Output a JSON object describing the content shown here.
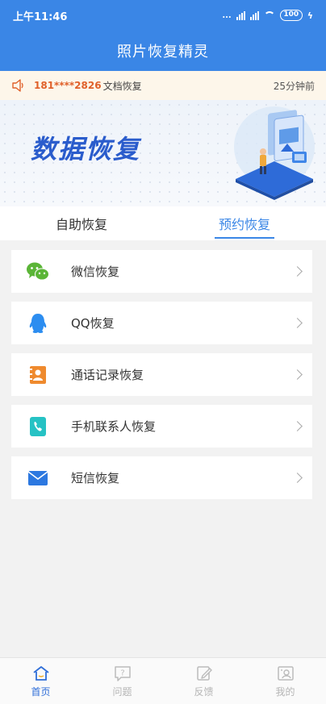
{
  "status": {
    "time": "上午11:46",
    "signal_text": "...",
    "battery": "100"
  },
  "header": {
    "title": "照片恢复精灵"
  },
  "notice": {
    "number": "181****2826",
    "text": "文档恢复",
    "time": "25分钟前"
  },
  "banner": {
    "title": "数据恢复"
  },
  "tabs": [
    {
      "label": "自助恢复",
      "active": false
    },
    {
      "label": "预约恢复",
      "active": true
    }
  ],
  "items": [
    {
      "label": "微信恢复",
      "icon": "wechat-icon",
      "color": "#5bb537"
    },
    {
      "label": "QQ恢复",
      "icon": "qq-icon",
      "color": "#2c8df0"
    },
    {
      "label": "通话记录恢复",
      "icon": "call-log-icon",
      "color": "#ef8a2e"
    },
    {
      "label": "手机联系人恢复",
      "icon": "contacts-icon",
      "color": "#26c2c4"
    },
    {
      "label": "短信恢复",
      "icon": "sms-icon",
      "color": "#2c78e0"
    }
  ],
  "bottom_nav": [
    {
      "label": "首页",
      "icon": "home-icon",
      "active": true
    },
    {
      "label": "问题",
      "icon": "question-icon",
      "active": false
    },
    {
      "label": "反馈",
      "icon": "feedback-icon",
      "active": false
    },
    {
      "label": "我的",
      "icon": "profile-icon",
      "active": false
    }
  ],
  "colors": {
    "primary": "#3a86e6",
    "notice_bg": "#fdf6ea",
    "notice_highlight": "#e0602a",
    "background": "#f2f2f2"
  }
}
